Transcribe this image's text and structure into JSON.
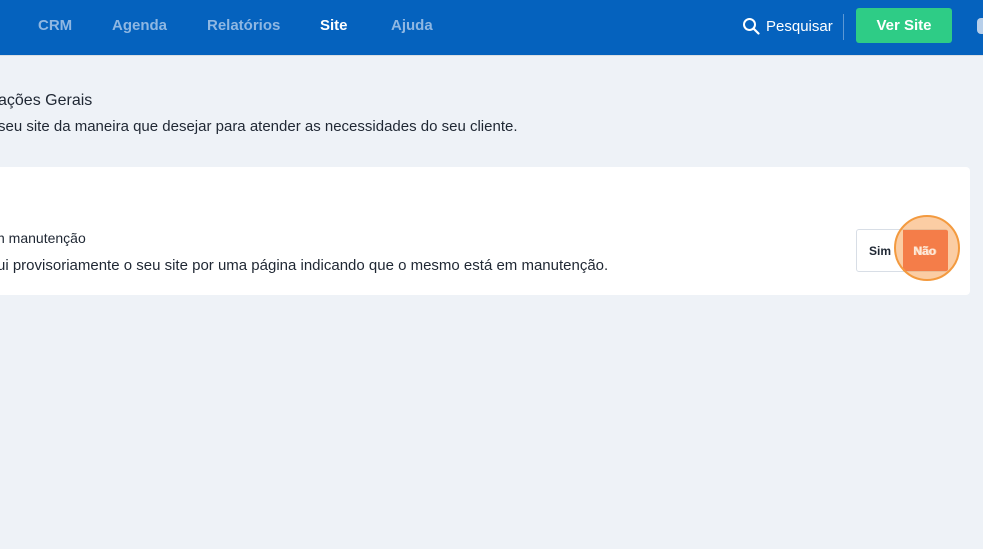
{
  "nav": {
    "items": [
      {
        "label": "CRM"
      },
      {
        "label": "Agenda"
      },
      {
        "label": "Relatórios"
      },
      {
        "label": "Site",
        "active": true
      },
      {
        "label": "Ajuda"
      }
    ],
    "search_label": "Pesquisar",
    "search_icon": "search-icon",
    "cta_label": "Ver Site"
  },
  "section": {
    "title": "ações Gerais",
    "subtitle": "seu site da maneira que desejar para atender as necessidades do seu cliente."
  },
  "setting": {
    "title": "n manutenção",
    "description": "ui provisoriamente o seu site por uma página indicando que o mesmo está em manutenção.",
    "options": {
      "yes": "Sim",
      "no": "Não"
    },
    "selected": "Não"
  },
  "colors": {
    "topbar": "#0562be",
    "nav_inactive": "#8fb7e2",
    "cta": "#2ecc86",
    "no_selected": "#f04e37",
    "click_highlight": "#f39a3f",
    "background": "#eef2f7"
  }
}
